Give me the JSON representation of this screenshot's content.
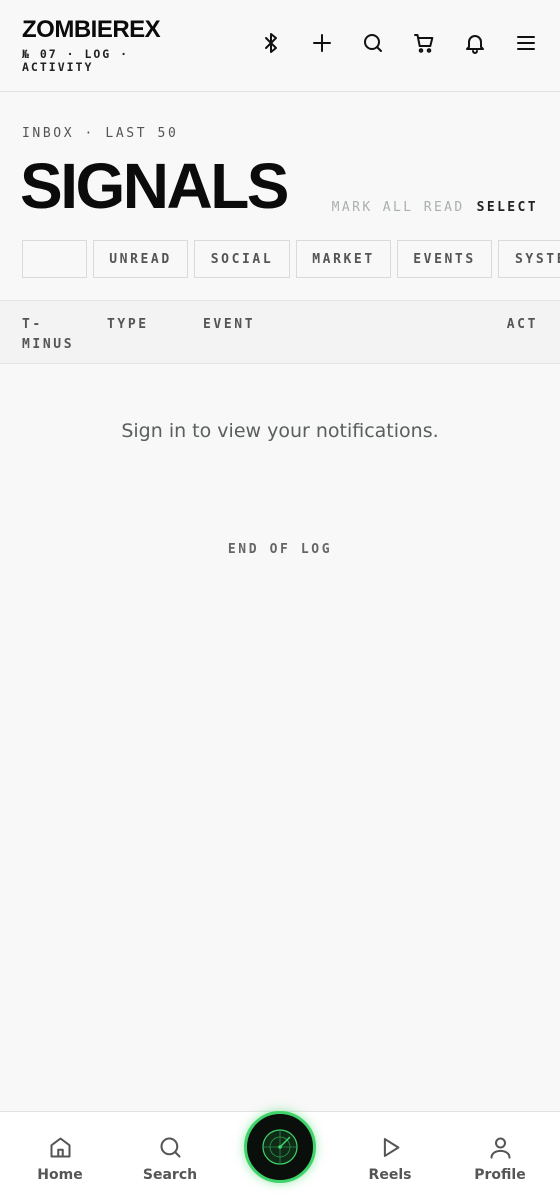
{
  "header": {
    "brand": "ZOMBIEREX",
    "subtitle": "№ 07 · LOG · ACTIVITY",
    "icons": [
      "bluetooth-icon",
      "plus-icon",
      "search-icon",
      "cart-icon",
      "bell-icon",
      "menu-icon"
    ]
  },
  "title_block": {
    "eyebrow": "INBOX · LAST 50",
    "title": "SIGNALS",
    "mark_all_read": "MARK ALL READ",
    "select": "SELECT"
  },
  "filters": {
    "chips": [
      "",
      "UNREAD",
      "SOCIAL",
      "MARKET",
      "EVENTS",
      "SYSTE"
    ]
  },
  "table": {
    "columns": [
      "T-MINUS",
      "TYPE",
      "EVENT",
      "ACT"
    ]
  },
  "content": {
    "empty_message": "Sign in to view your notifications.",
    "end_of_log": "END OF LOG"
  },
  "bottom_nav": {
    "items": [
      {
        "label": "Home",
        "icon": "home-icon"
      },
      {
        "label": "Search",
        "icon": "search-icon"
      },
      {
        "label": "Reels",
        "icon": "play-icon"
      },
      {
        "label": "Profile",
        "icon": "user-icon"
      }
    ],
    "center_icon": "radar-icon",
    "accent_color": "#3fd46a"
  }
}
